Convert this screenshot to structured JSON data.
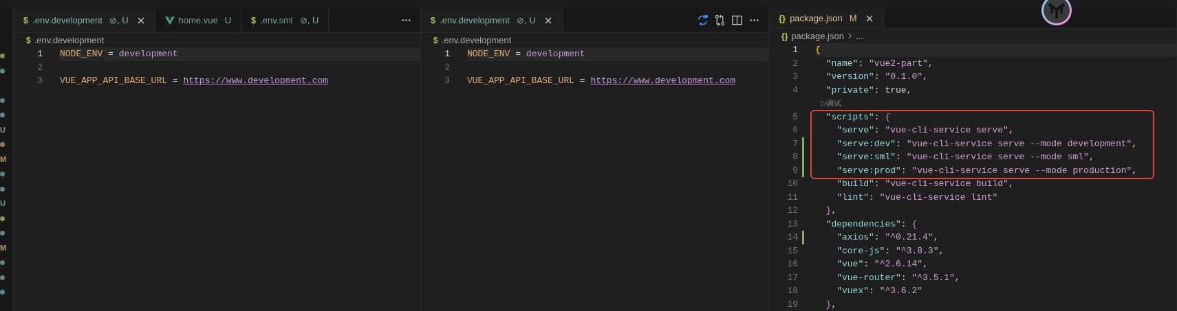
{
  "status_marks": [
    {
      "kind": "dot",
      "color": "#8a8f55"
    },
    {
      "kind": "dot",
      "color": "#5f8585"
    },
    {
      "kind": "blank"
    },
    {
      "kind": "dot",
      "color": "#5f8585"
    },
    {
      "kind": "dot",
      "color": "#5f8585"
    },
    {
      "kind": "letter",
      "text": "U",
      "color": "#6f9fa0"
    },
    {
      "kind": "dot",
      "color": "#8a7f5a"
    },
    {
      "kind": "letter",
      "text": "M",
      "color": "#b59a6a"
    },
    {
      "kind": "dot",
      "color": "#5f8585"
    },
    {
      "kind": "dot",
      "color": "#5f8585"
    },
    {
      "kind": "letter",
      "text": "U",
      "color": "#6f9fa0"
    },
    {
      "kind": "dot",
      "color": "#8a8f55"
    },
    {
      "kind": "dot",
      "color": "#5f8585"
    },
    {
      "kind": "letter",
      "text": "M",
      "color": "#b59a6a"
    },
    {
      "kind": "dot",
      "color": "#5f8585"
    },
    {
      "kind": "dot",
      "color": "#5f8585"
    },
    {
      "kind": "dot",
      "color": "#5f8585"
    }
  ],
  "panes": [
    {
      "tabs": [
        {
          "kind": "env",
          "icon": "$",
          "name": ".env.development",
          "status": "⊘, U",
          "color": "#7fb3b0",
          "selected": true
        },
        {
          "kind": "vue",
          "name": "home.vue",
          "status": "U",
          "color": "#7fb3b0",
          "selected": false
        },
        {
          "kind": "env",
          "icon": "$",
          "name": ".env.sml",
          "status": "⊘, U",
          "color": "#7fb3b0",
          "selected": false
        }
      ],
      "actions": [
        {
          "kind": "more"
        }
      ],
      "breadcrumb": {
        "icon": "$",
        "kind": "env",
        "items": [
          ".env.development"
        ]
      },
      "lines": [
        {
          "number": "1",
          "current": true,
          "tokens": [
            {
              "kind": "envkey",
              "s": "NODE_ENV"
            },
            {
              "kind": "punct",
              "s": " = "
            },
            {
              "kind": "envval",
              "s": "development"
            }
          ]
        },
        {
          "number": "2",
          "current": false
        },
        {
          "number": "3",
          "current": false,
          "tokens": [
            {
              "kind": "envkey",
              "s": "VUE_APP_API_BASE_URL"
            },
            {
              "kind": "punct",
              "s": " = "
            },
            {
              "kind": "link",
              "s": "https://www.development.com"
            }
          ]
        }
      ]
    },
    {
      "tabs": [
        {
          "kind": "env",
          "icon": "$",
          "name": ".env.development",
          "status": "⊘, U",
          "color": "#7fb3b0",
          "selected": true
        }
      ],
      "actions": [
        {
          "kind": "sync"
        },
        {
          "kind": "compare"
        },
        {
          "kind": "split"
        },
        {
          "kind": "more"
        }
      ],
      "breadcrumb": {
        "icon": "$",
        "kind": "env",
        "items": [
          ".env.development"
        ]
      },
      "lines": [
        {
          "number": "1",
          "current": true,
          "tokens": [
            {
              "kind": "envkey",
              "s": "NODE_ENV"
            },
            {
              "kind": "punct",
              "s": " = "
            },
            {
              "kind": "envval",
              "s": "development"
            }
          ]
        },
        {
          "number": "2",
          "current": false
        },
        {
          "number": "3",
          "current": false,
          "tokens": [
            {
              "kind": "envkey",
              "s": "VUE_APP_API_BASE_URL"
            },
            {
              "kind": "punct",
              "s": " = "
            },
            {
              "kind": "link",
              "s": "https://www.development.com"
            }
          ]
        }
      ]
    },
    {
      "tabs": [
        {
          "kind": "json",
          "icon": "{}",
          "name": "package.json",
          "status": "M",
          "color": "#e2c08d",
          "selected": true
        }
      ],
      "breadcrumb": {
        "icon": "{}",
        "kind": "json",
        "items": [
          "package.json",
          "..."
        ]
      },
      "lines": [
        {
          "number": "1",
          "current": true,
          "tokens": [
            {
              "kind": "brace1",
              "s": "{"
            }
          ]
        },
        {
          "number": "2",
          "current": false,
          "tokens": [
            {
              "kind": "key",
              "s": "  \"name\""
            },
            {
              "kind": "punct",
              "s": ": "
            },
            {
              "kind": "str",
              "s": "\"vue2-part\""
            },
            {
              "kind": "punct",
              "s": ","
            }
          ]
        },
        {
          "number": "3",
          "current": false,
          "tokens": [
            {
              "kind": "key",
              "s": "  \"version\""
            },
            {
              "kind": "punct",
              "s": ": "
            },
            {
              "kind": "str",
              "s": "\"0.1.0\""
            },
            {
              "kind": "punct",
              "s": ","
            }
          ]
        },
        {
          "number": "4",
          "current": false,
          "tokens": [
            {
              "kind": "key",
              "s": "  \"private\""
            },
            {
              "kind": "punct",
              "s": ": "
            },
            {
              "kind": "bool",
              "s": "true"
            },
            {
              "kind": "punct",
              "s": ","
            }
          ]
        },
        {
          "kind": "lens",
          "text": "▷调试"
        },
        {
          "number": "5",
          "current": false,
          "framed": true,
          "tokens": [
            {
              "kind": "key",
              "s": "  \"scripts\""
            },
            {
              "kind": "punct",
              "s": ": "
            },
            {
              "kind": "brace2",
              "s": "{"
            }
          ]
        },
        {
          "number": "6",
          "current": false,
          "framed": true,
          "tokens": [
            {
              "kind": "key",
              "s": "    \"serve\""
            },
            {
              "kind": "punct",
              "s": ": "
            },
            {
              "kind": "str",
              "s": "\"vue-cli-service serve\""
            },
            {
              "kind": "punct",
              "s": ","
            }
          ]
        },
        {
          "number": "7",
          "current": false,
          "framed": true,
          "changed": true,
          "tokens": [
            {
              "kind": "key",
              "s": "    \"serve:dev\""
            },
            {
              "kind": "punct",
              "s": ": "
            },
            {
              "kind": "str",
              "s": "\"vue-cli-service serve --mode development\""
            },
            {
              "kind": "punct",
              "s": ","
            }
          ]
        },
        {
          "number": "8",
          "current": false,
          "framed": true,
          "changed": true,
          "tokens": [
            {
              "kind": "key",
              "s": "    \"serve:sml\""
            },
            {
              "kind": "punct",
              "s": ": "
            },
            {
              "kind": "str",
              "s": "\"vue-cli-service serve --mode sml\""
            },
            {
              "kind": "punct",
              "s": ","
            }
          ]
        },
        {
          "number": "9",
          "current": false,
          "framed": true,
          "changed": true,
          "tokens": [
            {
              "kind": "key",
              "s": "    \"serve:prod\""
            },
            {
              "kind": "punct",
              "s": ": "
            },
            {
              "kind": "str",
              "s": "\"vue-cli-service serve --mode production\""
            },
            {
              "kind": "punct",
              "s": ","
            }
          ]
        },
        {
          "number": "10",
          "current": false,
          "tokens": [
            {
              "kind": "key",
              "s": "    \"build\""
            },
            {
              "kind": "punct",
              "s": ": "
            },
            {
              "kind": "str",
              "s": "\"vue-cli-service build\""
            },
            {
              "kind": "punct",
              "s": ","
            }
          ]
        },
        {
          "number": "11",
          "current": false,
          "tokens": [
            {
              "kind": "key",
              "s": "    \"lint\""
            },
            {
              "kind": "punct",
              "s": ": "
            },
            {
              "kind": "str",
              "s": "\"vue-cli-service lint\""
            }
          ]
        },
        {
          "number": "12",
          "current": false,
          "tokens": [
            {
              "kind": "brace2",
              "s": "  }"
            },
            {
              "kind": "punct",
              "s": ","
            }
          ]
        },
        {
          "number": "13",
          "current": false,
          "tokens": [
            {
              "kind": "key",
              "s": "  \"dependencies\""
            },
            {
              "kind": "punct",
              "s": ": "
            },
            {
              "kind": "brace2",
              "s": "{"
            }
          ]
        },
        {
          "number": "14",
          "current": false,
          "changed": true,
          "tokens": [
            {
              "kind": "key",
              "s": "    \"axios\""
            },
            {
              "kind": "punct",
              "s": ": "
            },
            {
              "kind": "str",
              "s": "\"^0.21.4\""
            },
            {
              "kind": "punct",
              "s": ","
            }
          ]
        },
        {
          "number": "15",
          "current": false,
          "tokens": [
            {
              "kind": "key",
              "s": "    \"core-js\""
            },
            {
              "kind": "punct",
              "s": ": "
            },
            {
              "kind": "str",
              "s": "\"^3.8.3\""
            },
            {
              "kind": "punct",
              "s": ","
            }
          ]
        },
        {
          "number": "16",
          "current": false,
          "tokens": [
            {
              "kind": "key",
              "s": "    \"vue\""
            },
            {
              "kind": "punct",
              "s": ": "
            },
            {
              "kind": "str",
              "s": "\"^2.6.14\""
            },
            {
              "kind": "punct",
              "s": ","
            }
          ]
        },
        {
          "number": "17",
          "current": false,
          "tokens": [
            {
              "kind": "key",
              "s": "    \"vue-router\""
            },
            {
              "kind": "punct",
              "s": ": "
            },
            {
              "kind": "str",
              "s": "\"^3.5.1\""
            },
            {
              "kind": "punct",
              "s": ","
            }
          ]
        },
        {
          "number": "18",
          "current": false,
          "tokens": [
            {
              "kind": "key",
              "s": "    \"vuex\""
            },
            {
              "kind": "punct",
              "s": ": "
            },
            {
              "kind": "str",
              "s": "\"^3.6.2\""
            }
          ]
        },
        {
          "number": "19",
          "current": false,
          "tokens": [
            {
              "kind": "brace2",
              "s": "  }"
            },
            {
              "kind": "punct",
              "s": ","
            }
          ]
        }
      ]
    }
  ]
}
